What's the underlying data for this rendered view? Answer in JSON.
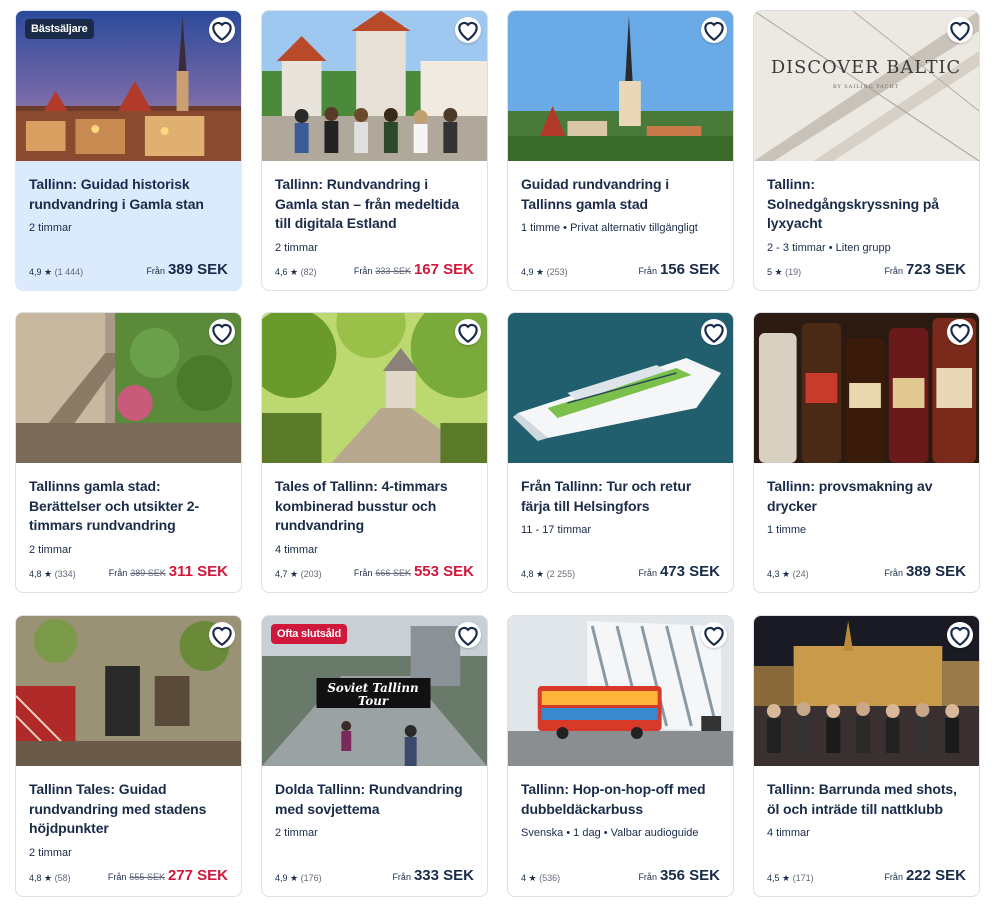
{
  "labels": {
    "from": "Från"
  },
  "cards": [
    {
      "badge": "Bästsäljare",
      "badge_style": "dark",
      "title": "Tallinn: Guidad historisk rundvandring i Gamla stan",
      "meta": "2 timmar",
      "rating": "4,9",
      "reviews": "(1 444)",
      "old_price": "",
      "price": "389 SEK",
      "sale": false,
      "highlight": true
    },
    {
      "badge": "",
      "title": "Tallinn: Rundvandring i Gamla stan – från medeltida till digitala Estland",
      "meta": "2 timmar",
      "rating": "4,6",
      "reviews": "(82)",
      "old_price": "333 SEK",
      "price": "167 SEK",
      "sale": true
    },
    {
      "badge": "",
      "title": "Guidad rundvandring i Tallinns gamla stad",
      "meta": "1 timme • Privat alternativ tillgängligt",
      "rating": "4,9",
      "reviews": "(253)",
      "old_price": "",
      "price": "156 SEK",
      "sale": false
    },
    {
      "badge": "",
      "title": "Tallinn: Solnedgångskryssning på lyxyacht",
      "meta": "2 - 3 timmar • Liten grupp",
      "rating": "5",
      "reviews": "(19)",
      "old_price": "",
      "price": "723 SEK",
      "sale": false,
      "image_text": "DISCOVER BALTIC",
      "image_subtext": "BY SAILING YACHT"
    },
    {
      "badge": "",
      "title": "Tallinns gamla stad: Berättelser och utsikter 2-timmars rundvandring",
      "meta": "2 timmar",
      "rating": "4,8",
      "reviews": "(334)",
      "old_price": "389 SEK",
      "price": "311 SEK",
      "sale": true
    },
    {
      "badge": "",
      "title": "Tales of Tallinn: 4-timmars kombinerad busstur och rundvandring",
      "meta": "4 timmar",
      "rating": "4,7",
      "reviews": "(203)",
      "old_price": "666 SEK",
      "price": "553 SEK",
      "sale": true
    },
    {
      "badge": "",
      "title": "Från Tallinn: Tur och retur färja till Helsingfors",
      "meta": "11 - 17 timmar",
      "rating": "4,8",
      "reviews": "(2 255)",
      "old_price": "",
      "price": "473 SEK",
      "sale": false
    },
    {
      "badge": "",
      "title": "Tallinn: provsmakning av drycker",
      "meta": "1 timme",
      "rating": "4,3",
      "reviews": "(24)",
      "old_price": "",
      "price": "389 SEK",
      "sale": false
    },
    {
      "badge": "",
      "title": "Tallinn Tales: Guidad rundvandring med stadens höjdpunkter",
      "meta": "2 timmar",
      "rating": "4,8",
      "reviews": "(58)",
      "old_price": "555 SEK",
      "price": "277 SEK",
      "sale": true
    },
    {
      "badge": "Ofta slutsåld",
      "badge_style": "red",
      "title": "Dolda Tallinn: Rundvandring med sovjettema",
      "meta": "2 timmar",
      "rating": "4,9",
      "reviews": "(176)",
      "old_price": "",
      "price": "333 SEK",
      "sale": false,
      "image_text": "Soviet Tallinn",
      "image_subtext": "Tour"
    },
    {
      "badge": "",
      "title": "Tallinn: Hop-on-hop-off med dubbeldäckarbuss",
      "meta": "Svenska • 1 dag • Valbar audioguide",
      "rating": "4",
      "reviews": "(536)",
      "old_price": "",
      "price": "356 SEK",
      "sale": false
    },
    {
      "badge": "",
      "title": "Tallinn: Barrunda med shots, öl och inträde till nattklubb",
      "meta": "4 timmar",
      "rating": "4,5",
      "reviews": "(171)",
      "old_price": "",
      "price": "222 SEK",
      "sale": false
    }
  ]
}
